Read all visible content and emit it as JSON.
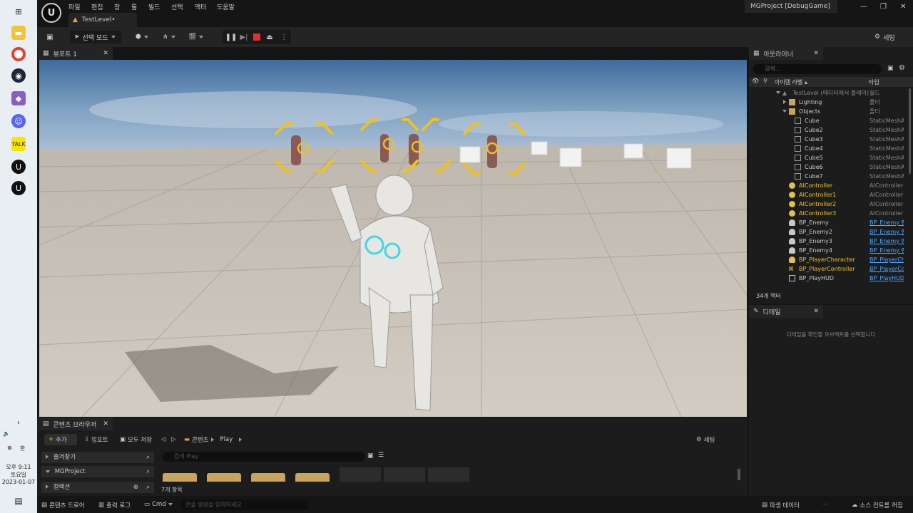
{
  "taskbar": {
    "clock_time": "오후 9:11",
    "clock_day": "토요일",
    "clock_date": "2023-01-07",
    "ime": "한"
  },
  "titlebar": {
    "menu": [
      "파일",
      "편집",
      "창",
      "툴",
      "빌드",
      "선택",
      "액터",
      "도움말"
    ],
    "level_tab": "TestLevel•",
    "project": "MGProject [DebugGame]"
  },
  "toolbar": {
    "mode_label": "선택 모드",
    "settings_label": "세팅"
  },
  "viewport": {
    "tab_label": "뷰포트 1"
  },
  "outliner": {
    "tab_label": "아웃라이너",
    "search_placeholder": "검색...",
    "col_label": "아이템 라벨 ▴",
    "col_type": "타입",
    "rows": [
      {
        "name": "TestLevel (에디터에서 플레이)",
        "type": "월드"
      },
      {
        "name": "Lighting",
        "type": "폴더"
      },
      {
        "name": "Objects",
        "type": "폴더"
      },
      {
        "name": "Cube",
        "type": "StaticMeshActor"
      },
      {
        "name": "Cube2",
        "type": "StaticMeshActor"
      },
      {
        "name": "Cube3",
        "type": "StaticMeshActor"
      },
      {
        "name": "Cube4",
        "type": "StaticMeshActor"
      },
      {
        "name": "Cube5",
        "type": "StaticMeshActor"
      },
      {
        "name": "Cube6",
        "type": "StaticMeshActor"
      },
      {
        "name": "Cube7",
        "type": "StaticMeshActor"
      },
      {
        "name": "AIController",
        "type": "AIController"
      },
      {
        "name": "AIController1",
        "type": "AIController"
      },
      {
        "name": "AIController2",
        "type": "AIController"
      },
      {
        "name": "AIController3",
        "type": "AIController"
      },
      {
        "name": "BP_Enemy",
        "type": "BP_Enemy 편집"
      },
      {
        "name": "BP_Enemy2",
        "type": "BP_Enemy 편집"
      },
      {
        "name": "BP_Enemy3",
        "type": "BP_Enemy 편집"
      },
      {
        "name": "BP_Enemy4",
        "type": "BP_Enemy 편집"
      },
      {
        "name": "BP_PlayerCharacter",
        "type": "BP_PlayerCharacter"
      },
      {
        "name": "BP_PlayerController",
        "type": "BP_PlayerController"
      },
      {
        "name": "BP_PlayHUD",
        "type": "BP_PlayHUD"
      }
    ],
    "actor_count": "34개 액터"
  },
  "details": {
    "tab_label": "디테일",
    "empty_text": "디테일을 확인할 오브젝트를 선택합니다"
  },
  "content_browser": {
    "tab_label": "콘텐츠 브라우저",
    "add_label": "추가",
    "import_label": "임포트",
    "save_all_label": "모두 저장",
    "path_root": "콘텐츠",
    "path_leaf": "Play",
    "settings_label": "세팅",
    "favorites": "즐겨찾기",
    "project": "MGProject",
    "collections": "컬렉션",
    "search_placeholder": "검색 Play",
    "item_count": "7개 항목"
  },
  "statusbar": {
    "content_drawer": "콘텐츠 드로어",
    "output_log": "출력 로그",
    "cmd": "Cmd",
    "cmd_placeholder": "콘솔 명령을 입력하세요",
    "derived_data": "파생 데이터",
    "source_control": "소스 컨트롤 꺼짐"
  },
  "colors": {
    "editor_bg": "#151515",
    "panel_bg": "#1c1c1c",
    "link_blue": "#4aa8ff",
    "reticle_yellow": "#f0c020",
    "stop_red": "#e03030"
  }
}
